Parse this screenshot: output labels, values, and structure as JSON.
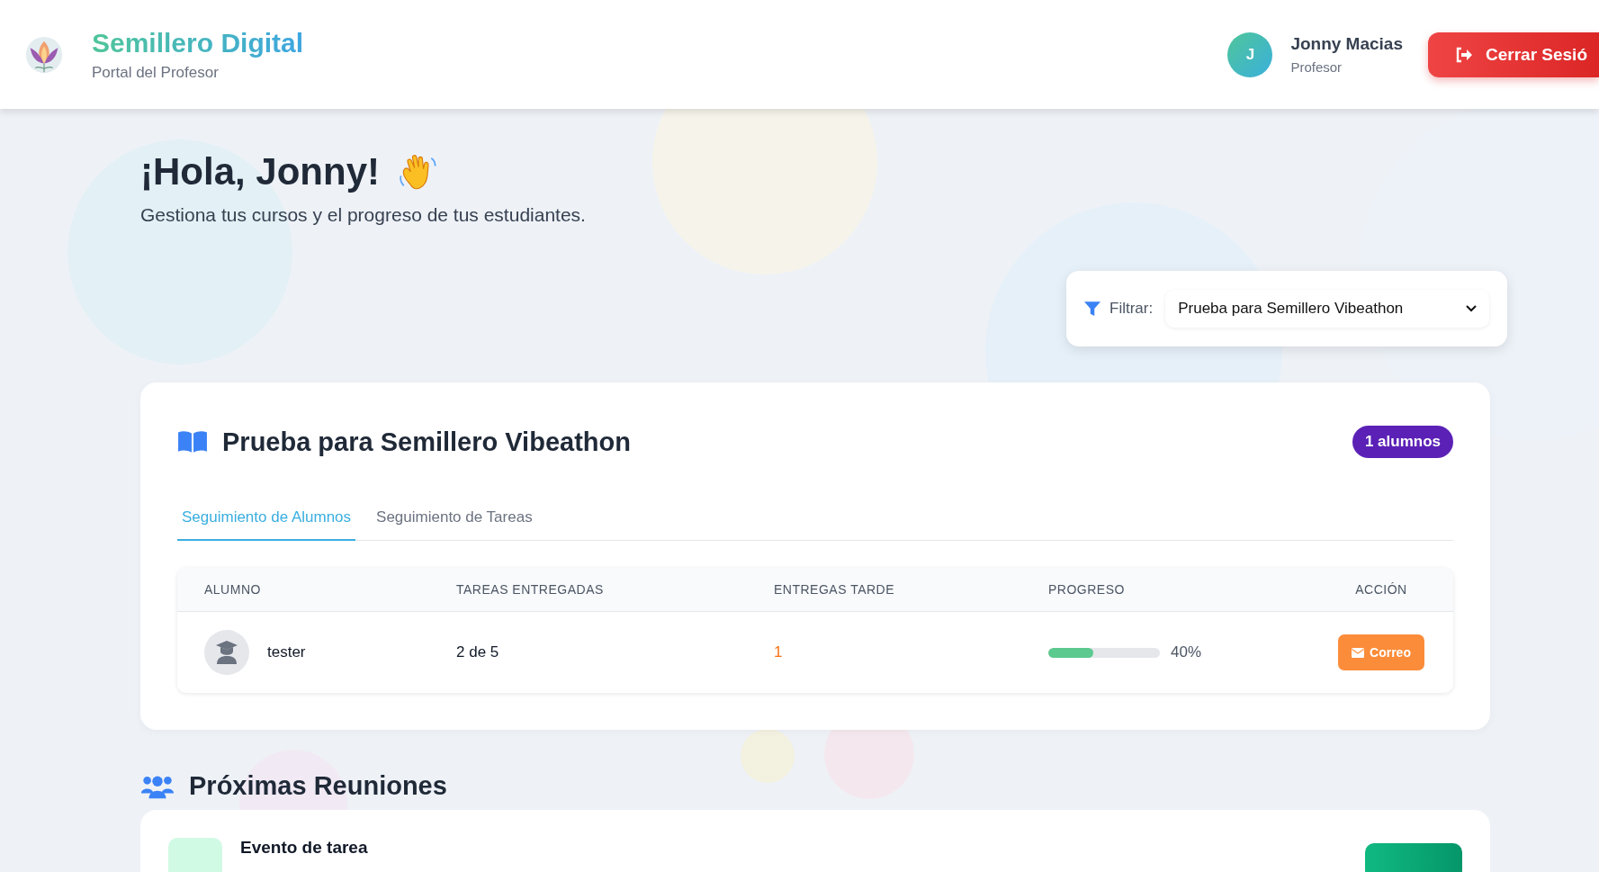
{
  "header": {
    "brand": {
      "title": "Semillero Digital",
      "subtitle": "Portal del Profesor"
    },
    "user": {
      "initial": "J",
      "name": "Jonny Macias",
      "role": "Profesor"
    },
    "logout_button": "Cerrar Sesió"
  },
  "greeting": {
    "title": "¡Hola, Jonny!",
    "subtitle": "Gestiona tus cursos y el progreso de tus estudiantes."
  },
  "filter": {
    "label": "Filtrar:",
    "value": "Prueba para Semillero Vibeathon"
  },
  "course": {
    "title": "Prueba para Semillero Vibeathon",
    "badge": "1 alumnos",
    "tabs": [
      {
        "label": "Seguimiento de Alumnos",
        "selected": true
      },
      {
        "label": "Seguimiento de Tareas",
        "selected": false
      }
    ],
    "table": {
      "columns": [
        "ALUMNO",
        "TAREAS ENTREGADAS",
        "ENTREGAS TARDE",
        "PROGRESO",
        "ACCIÓN"
      ],
      "rows": [
        {
          "student": "tester",
          "delivered": "2 de 5",
          "late": "1",
          "progress": {
            "level": 0.4,
            "reading": "40%"
          },
          "action": "Correo"
        }
      ]
    }
  },
  "meetings": {
    "title": "Próximas Reuniones",
    "items": [
      {
        "title": "Evento de tarea"
      }
    ]
  }
}
